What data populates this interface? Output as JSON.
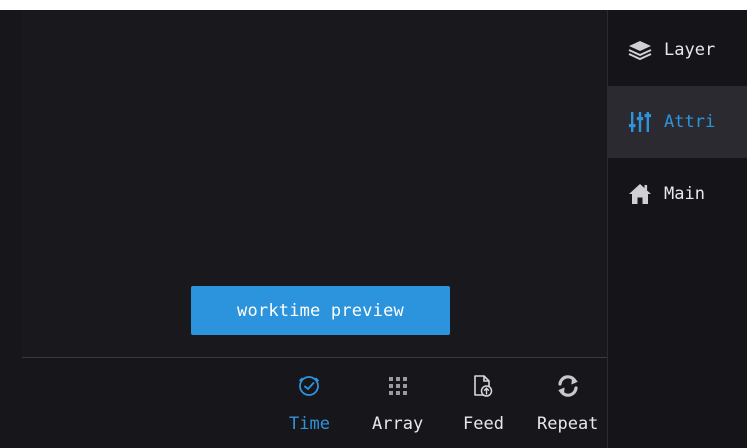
{
  "colors": {
    "background": "#17161b",
    "accent": "#2c94dc",
    "text": "#e8e8ea",
    "active_tab_bg": "#2b2a30"
  },
  "canvas": {
    "preview_button_label": "worktime preview"
  },
  "sidebar": {
    "items": [
      {
        "label": "Layer",
        "icon": "layers-icon",
        "active": false
      },
      {
        "label": "Attri",
        "icon": "sliders-icon",
        "active": true
      },
      {
        "label": "Main",
        "icon": "home-icon",
        "active": false
      }
    ]
  },
  "toolbar": {
    "items": [
      {
        "label": "Time",
        "icon": "clock-icon",
        "active": true
      },
      {
        "label": "Array",
        "icon": "grid-icon",
        "active": false
      },
      {
        "label": "Feed",
        "icon": "file-upload-icon",
        "active": false
      },
      {
        "label": "Repeat",
        "icon": "repeat-icon",
        "active": false
      }
    ]
  }
}
